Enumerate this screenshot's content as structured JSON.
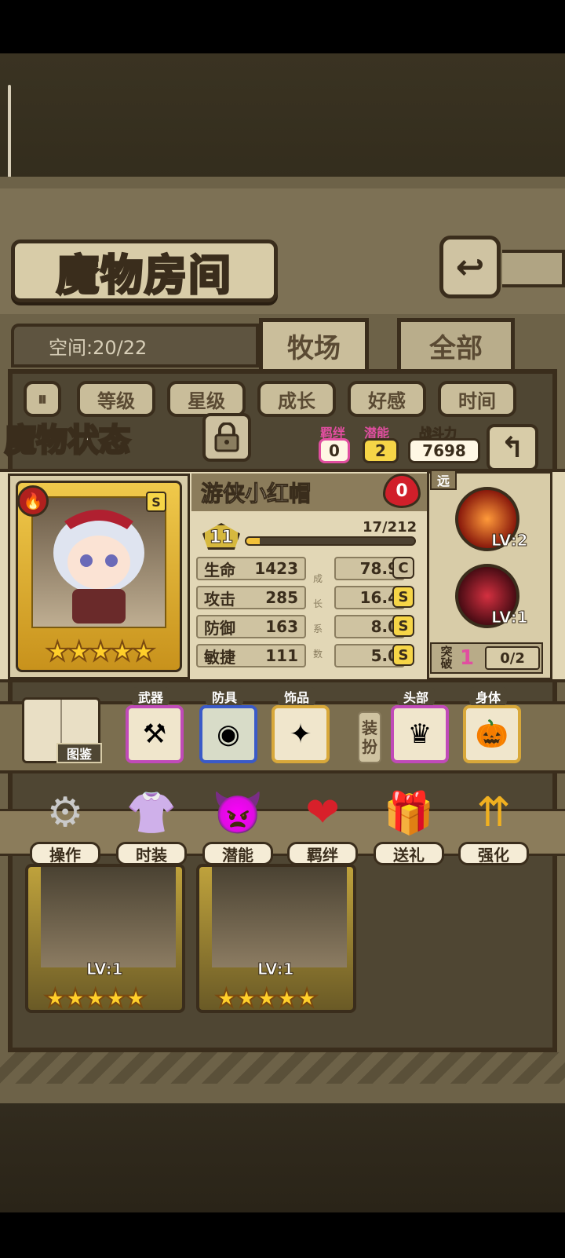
{
  "title": "魔物房间",
  "space": {
    "text": "空间:20/22"
  },
  "tabs": [
    {
      "label": "牧场"
    },
    {
      "label": "全部"
    }
  ],
  "sort_buttons": [
    "等级",
    "星级",
    "成长",
    "好感",
    "时间"
  ],
  "status": {
    "title": "魔物状态",
    "bond_label": "羁绊",
    "bond": "0",
    "potential_label": "潜能",
    "potential": "2",
    "power_label": "战斗力",
    "power": "7698"
  },
  "monster": {
    "name": "游侠小红帽",
    "affection": "0",
    "grade": "S",
    "stars": "★★★★★",
    "level": "11",
    "exp_text": "17/212",
    "exp_fraction": 0.08,
    "stats": [
      {
        "label": "生命",
        "value": "1423",
        "growth": "78.9",
        "grade": "C",
        "color": "#cfc3a1"
      },
      {
        "label": "攻击",
        "value": "285",
        "growth": "16.4",
        "grade": "S",
        "color": "#f6d547"
      },
      {
        "label": "防御",
        "value": "163",
        "growth": "8.0",
        "grade": "S",
        "color": "#f6d547"
      },
      {
        "label": "敏捷",
        "value": "111",
        "growth": "5.0",
        "grade": "S",
        "color": "#f6d547"
      }
    ],
    "growth_chars": [
      "成",
      "长",
      "系",
      "数"
    ],
    "range": "远",
    "skills": [
      {
        "level": "LV:2"
      },
      {
        "level": "LV:1"
      }
    ],
    "breakthrough": {
      "label1": "突",
      "label2": "破",
      "value": "1",
      "progress": "0/2"
    }
  },
  "equipment": {
    "handbook": "图鉴",
    "slots": [
      {
        "label": "武器",
        "icon": "⚒",
        "border": "#c04ab8",
        "bg": "#f0e6cc"
      },
      {
        "label": "防具",
        "icon": "◉",
        "border": "#3a5ac8",
        "bg": "#d8dcc8"
      },
      {
        "label": "饰品",
        "icon": "✦",
        "border": "#d8a83a",
        "bg": "#f0e6cc"
      },
      {
        "label": "头部",
        "icon": "♛",
        "border": "#c04ab8",
        "bg": "#f0e6cc"
      },
      {
        "label": "身体",
        "icon": "🎃",
        "border": "#d8a83a",
        "bg": "#f0e6cc"
      }
    ],
    "dress_up": [
      "装",
      "扮"
    ]
  },
  "actions": [
    {
      "label": "操作",
      "icon": "⚙",
      "color": "#c9c9c9"
    },
    {
      "label": "时装",
      "icon": "👚",
      "color": "#f0a0d8"
    },
    {
      "label": "潜能",
      "icon": "👿",
      "color": "#7a4ad0"
    },
    {
      "label": "羁绊",
      "icon": "❤",
      "color": "#d8202a"
    },
    {
      "label": "送礼",
      "icon": "🎁",
      "color": "#e8c43a"
    },
    {
      "label": "强化",
      "icon": "⇈",
      "color": "#f0b020"
    }
  ],
  "monster_list": [
    {
      "level": "LV:1",
      "stars": "★★★★★"
    },
    {
      "level": "LV:1",
      "stars": "★★★★★"
    }
  ]
}
